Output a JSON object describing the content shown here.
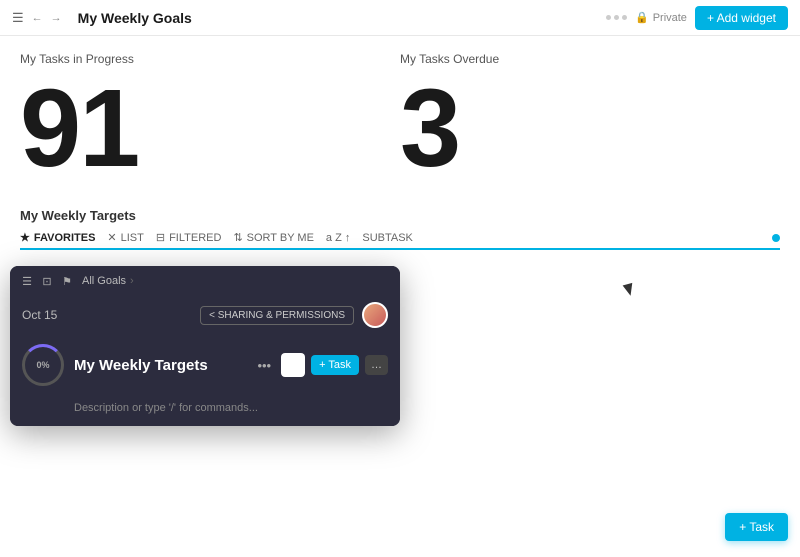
{
  "topbar": {
    "title": "My Weekly Goals",
    "private_label": "Private",
    "add_widget_label": "+ Add widget"
  },
  "stats": {
    "in_progress_label": "My Tasks in Progress",
    "in_progress_value": "91",
    "overdue_label": "My Tasks Overdue",
    "overdue_value": "3"
  },
  "weekly_targets": {
    "section_label": "My Weekly Targets",
    "filters": [
      {
        "label": "FAVORITES",
        "icon": "star"
      },
      {
        "label": "LIST",
        "icon": "x"
      },
      {
        "label": "FILTERED",
        "icon": "filter"
      },
      {
        "label": "SORT BY ME",
        "icon": "sort"
      },
      {
        "label": "a  Z  ↑",
        "icon": ""
      },
      {
        "label": "SUBTASK",
        "icon": ""
      }
    ]
  },
  "overlay": {
    "breadcrumb": "All Goals",
    "date": "Oct 15",
    "sharing_label": "< SHARING & PERMISSIONS",
    "task_title": "My Weekly Targets",
    "progress_label": "0%",
    "add_task_label": "+ Task",
    "description_placeholder": "Description or type '/' for commands..."
  },
  "bottom_btn": {
    "label": "+ Task"
  }
}
